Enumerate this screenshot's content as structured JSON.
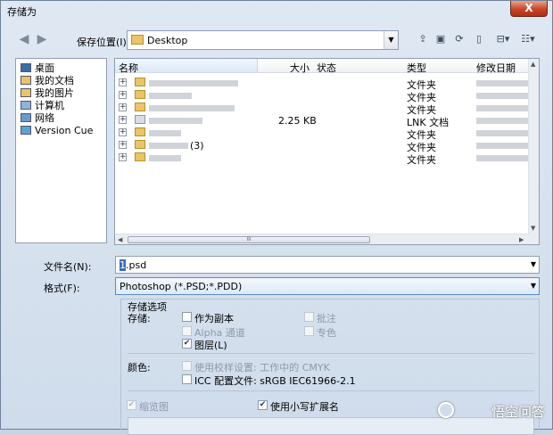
{
  "window": {
    "title": "存储为",
    "close_label": "X"
  },
  "toolbar": {
    "location_label": "保存位置(I):",
    "location_value": "Desktop",
    "location_arrow": "▼",
    "back_glyph": "◀",
    "forward_glyph": "▶",
    "buttons": [
      "up-folder-icon",
      "new-folder-icon",
      "refresh-icon",
      "delete-icon",
      "network-drive-icon",
      "view-menu-icon"
    ]
  },
  "places": [
    "桌面",
    "我的文档",
    "我的图片",
    "计算机",
    "网络",
    "Version Cue"
  ],
  "file_list": {
    "columns": [
      "名称",
      "大小",
      "状态",
      "类型",
      "修改日期"
    ],
    "rows": [
      {
        "name": "",
        "size": "",
        "type": "文件夹"
      },
      {
        "name": "",
        "size": "",
        "type": "文件夹"
      },
      {
        "name": "",
        "size": "",
        "type": "文件夹"
      },
      {
        "name": "",
        "size": "2.25 KB",
        "type": "LNK 文档"
      },
      {
        "name": "",
        "size": "",
        "type": "文件夹"
      },
      {
        "name": "(3)",
        "size": "",
        "type": "文件夹"
      },
      {
        "name": "",
        "size": "",
        "type": "文件夹"
      }
    ]
  },
  "filename": {
    "label": "文件名(N):",
    "value": "1.psd",
    "selected_part": "1",
    "rest": ".psd"
  },
  "format": {
    "label": "格式(F):",
    "value": "Photoshop (*.PSD;*.PDD)"
  },
  "save_options": {
    "title": "存储选项",
    "store_label": "存储:",
    "as_copy": "作为副本",
    "alpha": "Alpha 通道",
    "layers": "图层(L)",
    "annotations": "批注",
    "spot": "专色",
    "color_label": "颜色:",
    "use_proof": "使用校样设置: 工作中的 CMYK",
    "icc": "ICC 配置文件: sRGB IEC61966-2.1",
    "thumbnail": "缩览图",
    "lowercase_ext": "使用小写扩展名"
  },
  "watermark": "悟空问答"
}
